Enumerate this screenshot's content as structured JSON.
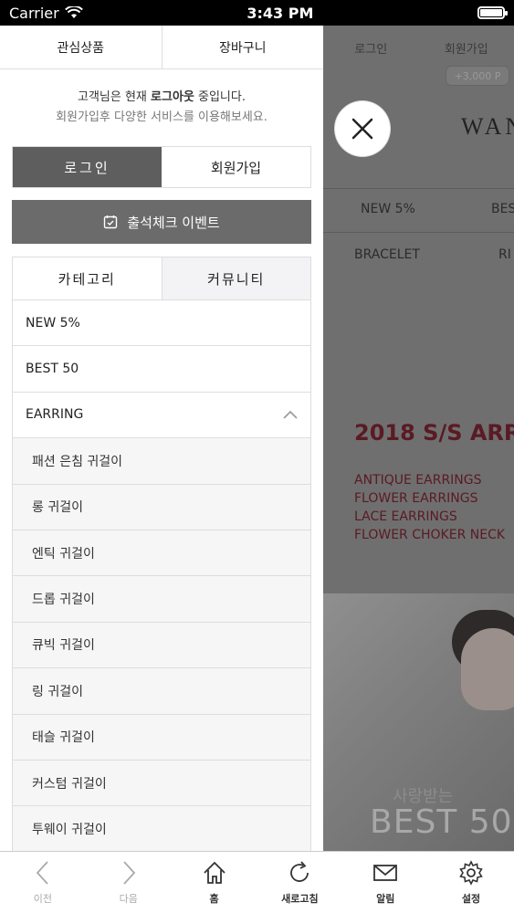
{
  "status_bar": {
    "carrier": "Carrier",
    "time": "3:43 PM"
  },
  "background_page": {
    "top_links": [
      "로그인",
      "회원가입"
    ],
    "point_badge": "+3,000 P",
    "logo": "WAN",
    "nav_row1": [
      "NEW 5%",
      "BES"
    ],
    "nav_row2": [
      "BRACELET",
      "RI"
    ],
    "headline": "2018 S/S ARR",
    "feature_list": [
      "ANTIQUE EARRINGS",
      "FLOWER EARRINGS",
      "LACE EARRINGS",
      "FLOWER CHOKER NECK"
    ],
    "banner_line1": "사랑받는",
    "banner_line2": "BEST 50"
  },
  "drawer": {
    "top_tabs": [
      "관심상품",
      "장바구니"
    ],
    "info_prefix": "고객님은 현재 ",
    "info_bold": "로그아웃",
    "info_suffix": " 중입니다.",
    "info_sub": "회원가입후 다양한 서비스를 이용해보세요.",
    "login_label": "로그인",
    "join_label": "회원가입",
    "event_label": "출석체크 이벤트",
    "category_tab": "카테고리",
    "community_tab": "커뮤니티",
    "menu": [
      {
        "label": "NEW 5%"
      },
      {
        "label": "BEST 50"
      },
      {
        "label": "EARRING"
      }
    ],
    "earring_sub": [
      "패션 은침 귀걸이",
      "롱 귀걸이",
      "엔틱 귀걸이",
      "드롭 귀걸이",
      "큐빅 귀걸이",
      "링 귀걸이",
      "태슬 귀걸이",
      "커스텀 귀걸이",
      "투웨이 귀걸이"
    ]
  },
  "toolbar": [
    {
      "label": "이전",
      "icon": "chevron-left-icon",
      "enabled": false
    },
    {
      "label": "다음",
      "icon": "chevron-right-icon",
      "enabled": false
    },
    {
      "label": "홈",
      "icon": "home-icon",
      "enabled": true
    },
    {
      "label": "새로고침",
      "icon": "refresh-icon",
      "enabled": true
    },
    {
      "label": "알림",
      "icon": "mail-icon",
      "enabled": true
    },
    {
      "label": "설정",
      "icon": "gear-icon",
      "enabled": true
    }
  ]
}
